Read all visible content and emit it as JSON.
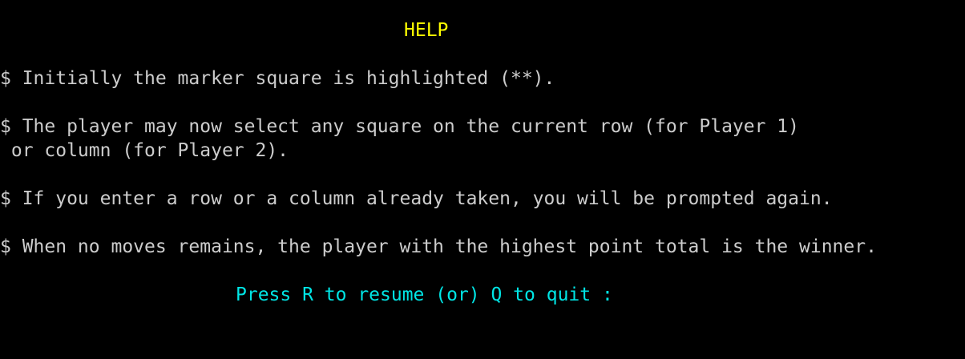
{
  "colors": {
    "background": "#000000",
    "text": "#cccccc",
    "title": "#ffff00",
    "prompt": "#00e5e5"
  },
  "help": {
    "title": "HELP",
    "lines": [
      "$ Initially the marker square is highlighted (**).",
      "$ The player may now select any square on the current row (for Player 1)",
      " or column (for Player 2).",
      "$ If you enter a row or a column already taken, you will be prompted again.",
      "$ When no moves remains, the player with the highest point total is the winner."
    ],
    "prompt": "Press R to resume (or) Q to quit :"
  }
}
